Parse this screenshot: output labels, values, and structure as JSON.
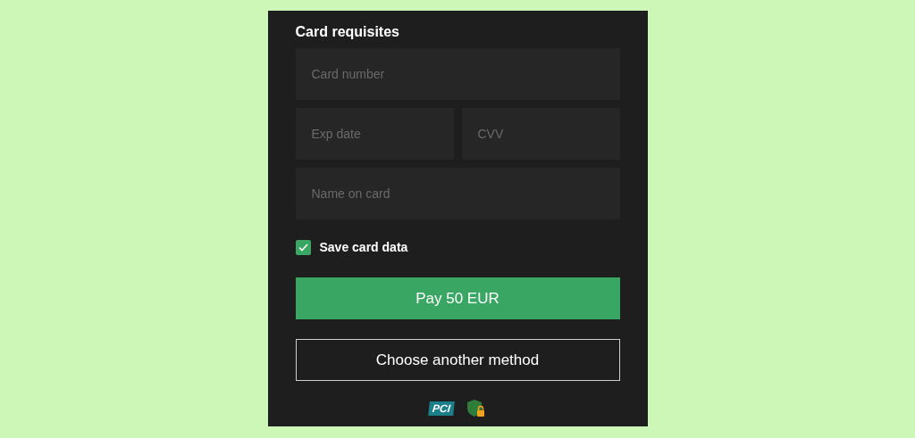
{
  "form": {
    "title": "Card requisites",
    "fields": [
      {
        "placeholder": "Card number"
      },
      {
        "placeholder": "Exp date"
      },
      {
        "placeholder": "CVV"
      },
      {
        "placeholder": "Name on card"
      }
    ],
    "save_card": {
      "label": "Save card data",
      "checked": true
    },
    "buttons": [
      {
        "kind": "primary",
        "label": "Pay 50 EUR"
      },
      {
        "kind": "outline",
        "label": "Choose another method"
      }
    ],
    "badges": [
      {
        "kind": "pci",
        "label": "PCI"
      },
      {
        "kind": "ssl"
      }
    ]
  }
}
